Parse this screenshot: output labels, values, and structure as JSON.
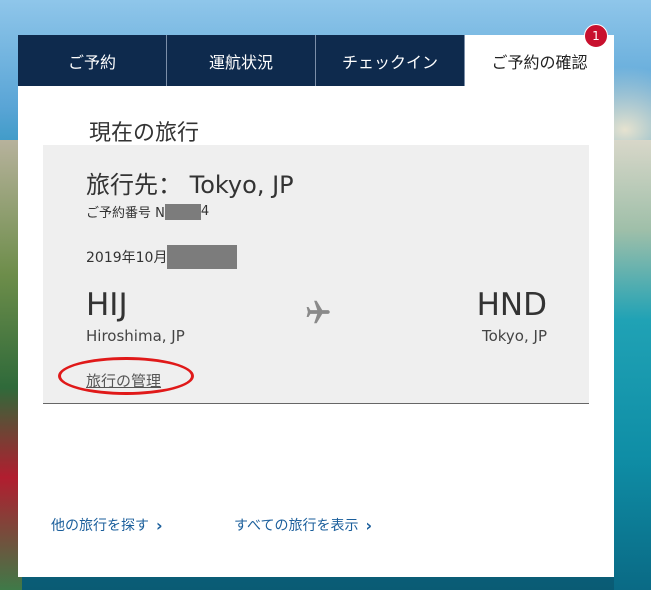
{
  "tabs": [
    {
      "label": "ご予約"
    },
    {
      "label": "運航状況"
    },
    {
      "label": "チェックイン"
    },
    {
      "label": "ご予約の確認"
    }
  ],
  "badge_count": "1",
  "current_trips_title": "現在の旅行",
  "trip": {
    "destination": "旅行先： Tokyo, JP",
    "confirmation_prefix": "ご予約番号 N",
    "confirmation_suffix": "4",
    "date_prefix": "2019年10月",
    "origin_code": "HIJ",
    "origin_city": "Hiroshima, JP",
    "dest_code": "HND",
    "dest_city": "Tokyo, JP",
    "manage_link": "旅行の管理"
  },
  "links": {
    "find_other": "他の旅行を探す",
    "show_all": "すべての旅行を表示"
  },
  "icons": {
    "plane": "airplane-icon",
    "chevron": "chevron-right-icon"
  },
  "colors": {
    "tab_bg": "#0e2a4d",
    "badge": "#c8102e",
    "link": "#1a5e9b",
    "highlight_ring": "#e01919"
  }
}
